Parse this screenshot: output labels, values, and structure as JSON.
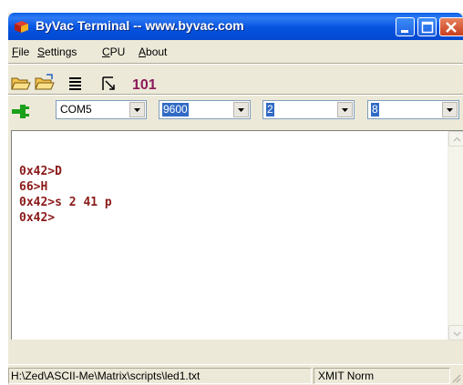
{
  "window": {
    "title": "ByVac Terminal -- www.byvac.com"
  },
  "menu": {
    "file": "File",
    "settings": "Settings",
    "cpu": "CPU",
    "about": "About"
  },
  "toolbar": {
    "icons": [
      "open-folder-icon",
      "open-folder-2-icon",
      "text-lines-icon",
      "send-icon",
      "binary-icon"
    ],
    "binary_glyph": "101"
  },
  "connection": {
    "port": "COM5",
    "baud": "9600",
    "field3": "2",
    "field4": "8"
  },
  "terminal": {
    "lines": [
      "0x42>D",
      "66>H",
      "0x42>s 2 41 p",
      "0x42>"
    ],
    "text_color": "#8b1a1a"
  },
  "status": {
    "path": "H:\\Zed\\ASCII-Me\\Matrix\\scripts\\led1.txt",
    "mode": "XMIT Norm"
  }
}
